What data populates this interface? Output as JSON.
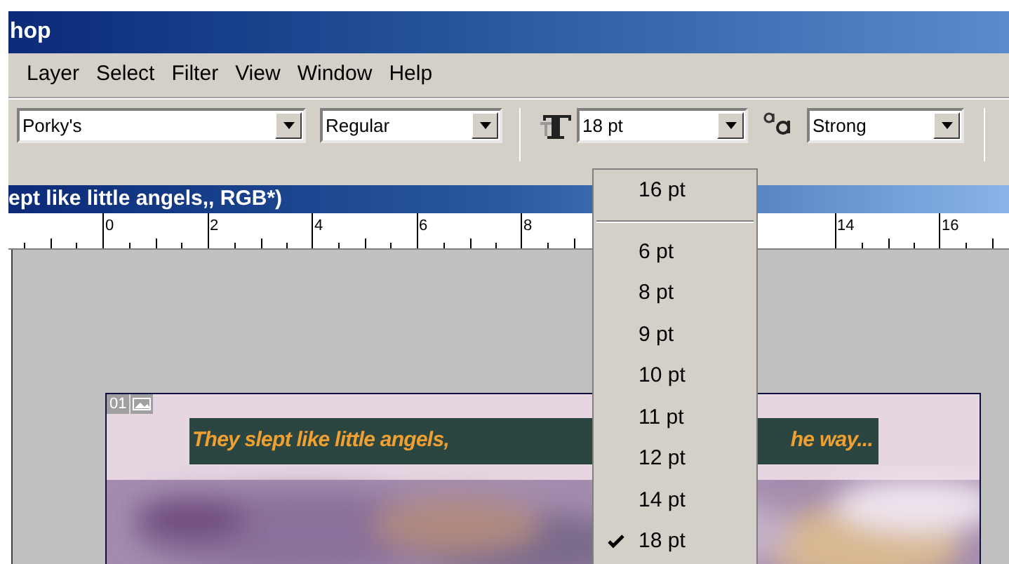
{
  "window": {
    "title": "hop"
  },
  "menu": [
    {
      "label": "Layer"
    },
    {
      "label": "Select"
    },
    {
      "label": "Filter"
    },
    {
      "label": "View"
    },
    {
      "label": "Window"
    },
    {
      "label": "Help"
    }
  ],
  "options_bar": {
    "font_family": "Porky's",
    "font_style": "Regular",
    "font_size": "18 pt",
    "anti_alias": "Strong"
  },
  "size_menu": {
    "recent": [
      {
        "label": "16 pt"
      }
    ],
    "items": [
      {
        "label": "6 pt",
        "selected": false
      },
      {
        "label": "8 pt",
        "selected": false
      },
      {
        "label": "9 pt",
        "selected": false
      },
      {
        "label": "10 pt",
        "selected": false
      },
      {
        "label": "11 pt",
        "selected": false
      },
      {
        "label": "12 pt",
        "selected": false
      },
      {
        "label": "14 pt",
        "selected": false
      },
      {
        "label": "18 pt",
        "selected": true
      }
    ]
  },
  "document": {
    "title": "ept like little angels,, RGB*)",
    "ruler": {
      "left_labels": [
        "0",
        "2",
        "4",
        "6",
        "8"
      ],
      "right_labels": [
        "14",
        "16"
      ]
    },
    "layer_badge": "01",
    "caption": {
      "left": "They slept like little angels,",
      "right": "he way..."
    }
  }
}
